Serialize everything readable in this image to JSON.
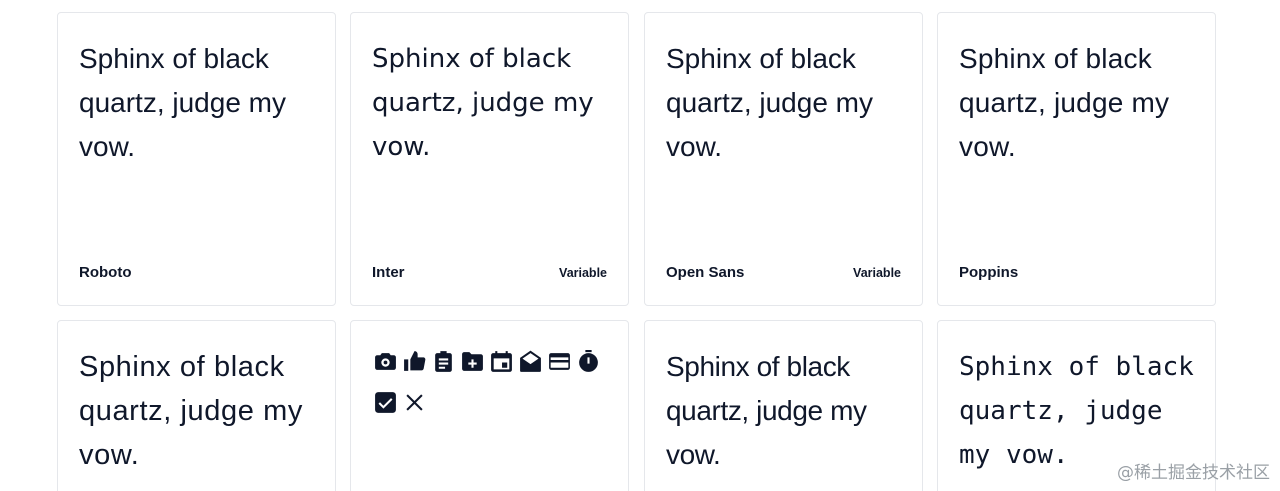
{
  "cards": [
    {
      "sample": "Sphinx of black quartz, judge my vow.",
      "name": "Roboto",
      "tag": ""
    },
    {
      "sample": "Sphinx of black quartz, judge my vow.",
      "name": "Inter",
      "tag": "Variable"
    },
    {
      "sample": "Sphinx of black quartz, judge my vow.",
      "name": "Open Sans",
      "tag": "Variable"
    },
    {
      "sample": "Sphinx of black quartz, judge my vow.",
      "name": "Poppins",
      "tag": ""
    },
    {
      "sample": "Sphinx of black quartz, judge my vow.",
      "name": "",
      "tag": ""
    },
    {
      "sample": "",
      "name": "",
      "tag": "",
      "icons": [
        "camera-icon",
        "thumbs-up-icon",
        "clipboard-icon",
        "folder-plus-icon",
        "calendar-icon",
        "envelope-open-icon",
        "credit-card-icon",
        "stopwatch-icon",
        "check-square-icon",
        "close-icon"
      ]
    },
    {
      "sample": "Sphinx of black quartz, judge my vow.",
      "name": "",
      "tag": ""
    },
    {
      "sample": "Sphinx of black quartz, judge my vow.",
      "name": "",
      "tag": ""
    }
  ],
  "watermark": "@稀土掘金技术社区",
  "colors": {
    "text": "#0f172a",
    "border": "#e5e7eb",
    "background": "#ffffff",
    "watermark": "#9aa0a6"
  }
}
